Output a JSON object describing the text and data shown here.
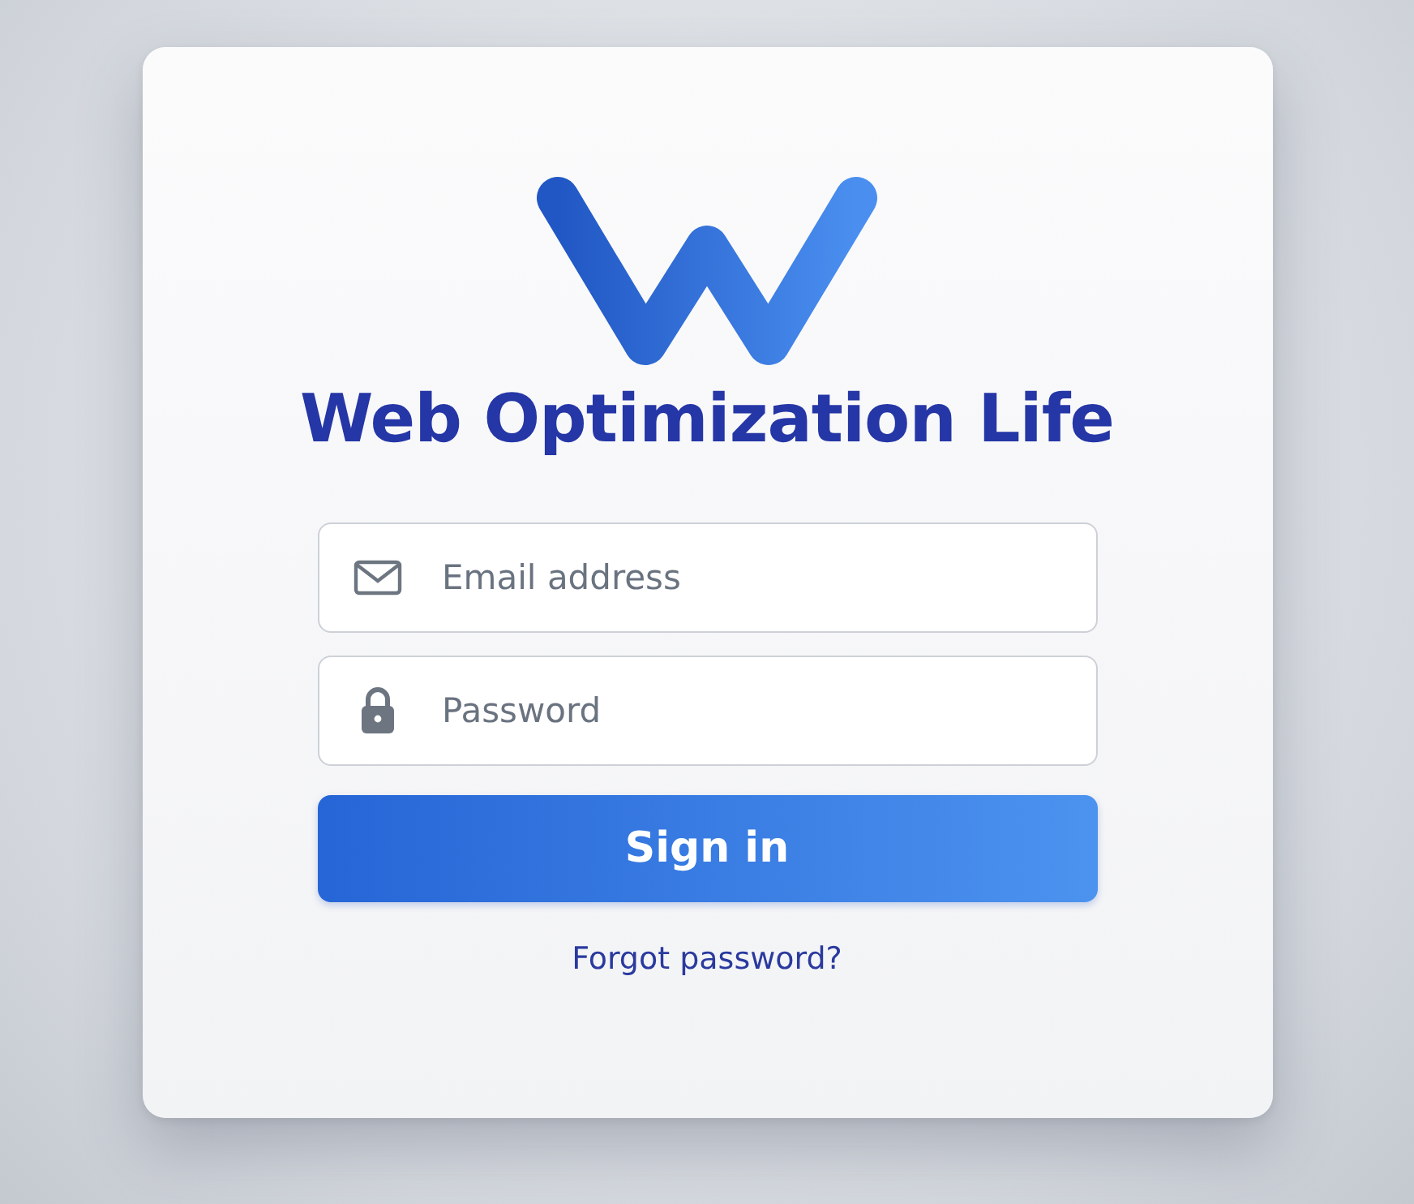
{
  "brand": {
    "name": "Web Optimization Life"
  },
  "fields": [
    {
      "kind": "email",
      "placeholder": "Email address"
    },
    {
      "kind": "password",
      "placeholder": "Password"
    }
  ],
  "submit": {
    "label": "Sign in"
  },
  "link": {
    "label": "Forgot password?"
  }
}
